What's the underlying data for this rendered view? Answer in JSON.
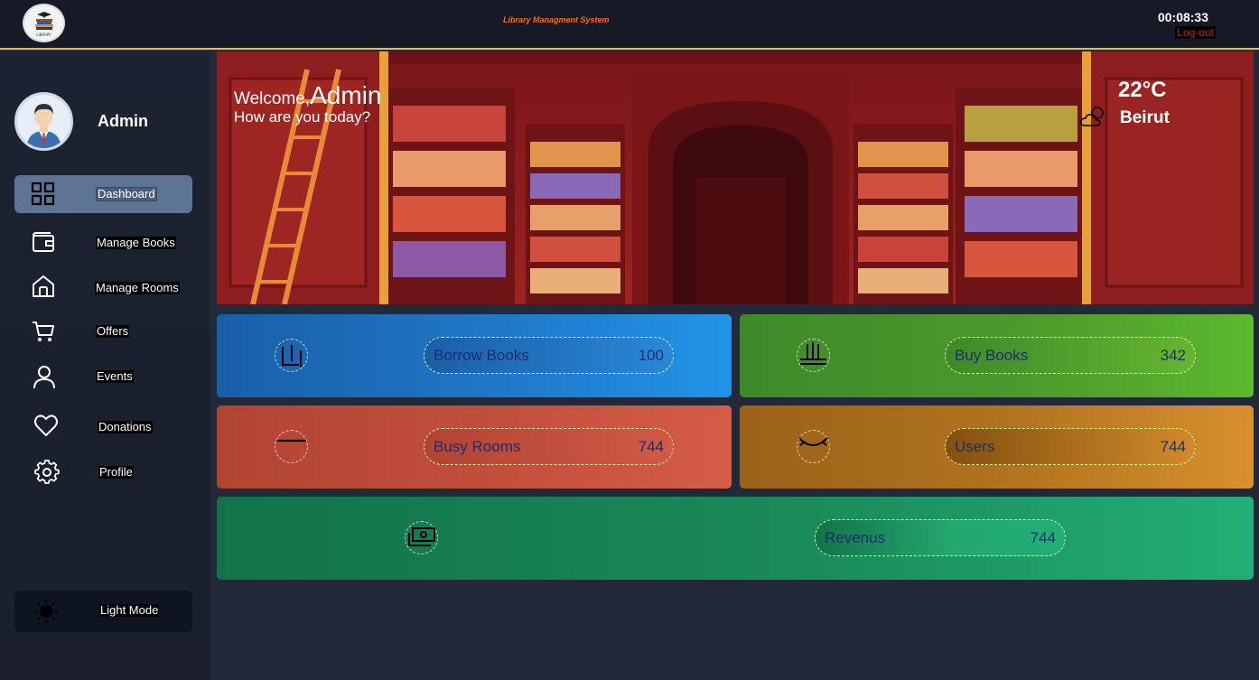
{
  "header": {
    "logo_text": "LIBRARY",
    "app_title": "Library Managment System",
    "clock": "00:08:33",
    "logout_label": "Log-out"
  },
  "sidebar": {
    "profile_name": "Admin",
    "items": [
      {
        "label": "Dashboard",
        "icon": "grid-icon",
        "active": true
      },
      {
        "label": "Manage Books",
        "icon": "wallet-icon"
      },
      {
        "label": "Manage Rooms",
        "icon": "home-icon"
      },
      {
        "label": "Offers",
        "icon": "cart-icon"
      },
      {
        "label": "Events",
        "icon": "user-icon"
      },
      {
        "label": "Donations",
        "icon": "heart-icon"
      },
      {
        "label": "Profile",
        "icon": "gear-icon"
      }
    ],
    "light_mode_label": "Light Mode"
  },
  "banner": {
    "welcome": "Welcome,",
    "name": "Admin",
    "subtitle": "How are you today?",
    "temperature": "22°C",
    "city": "Beirut"
  },
  "cards": {
    "borrow": {
      "label": "Borrow Books",
      "value": "100"
    },
    "buy": {
      "label": "Buy Books",
      "value": "342"
    },
    "rooms": {
      "label": "Busy Rooms",
      "value": "744"
    },
    "users": {
      "label": "Users",
      "value": "744"
    },
    "revenue": {
      "label": "Revenus",
      "value": "744"
    }
  },
  "colors": {
    "accent": "#e6c12b",
    "title": "#ff6a1a",
    "logout": "#d11c1c",
    "active_nav": "#5e7495"
  }
}
